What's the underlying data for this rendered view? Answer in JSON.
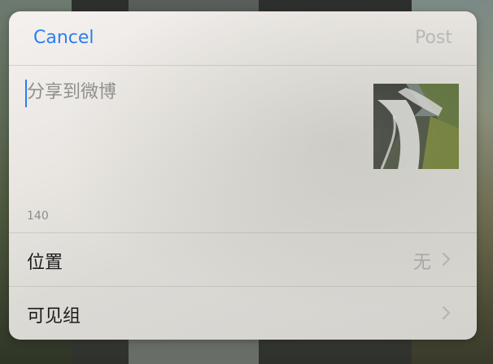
{
  "nav": {
    "cancel_label": "Cancel",
    "post_label": "Post"
  },
  "compose": {
    "placeholder": "分享到微博",
    "char_count": "140",
    "attachment_icon": "waterfall-photo-thumbnail"
  },
  "options": {
    "location_label": "位置",
    "location_value": "无",
    "visibility_label": "可见组"
  },
  "colors": {
    "accent": "#2b7ef2",
    "disabled": "#b9b9b6",
    "secondary_text": "#8f8f8c"
  }
}
